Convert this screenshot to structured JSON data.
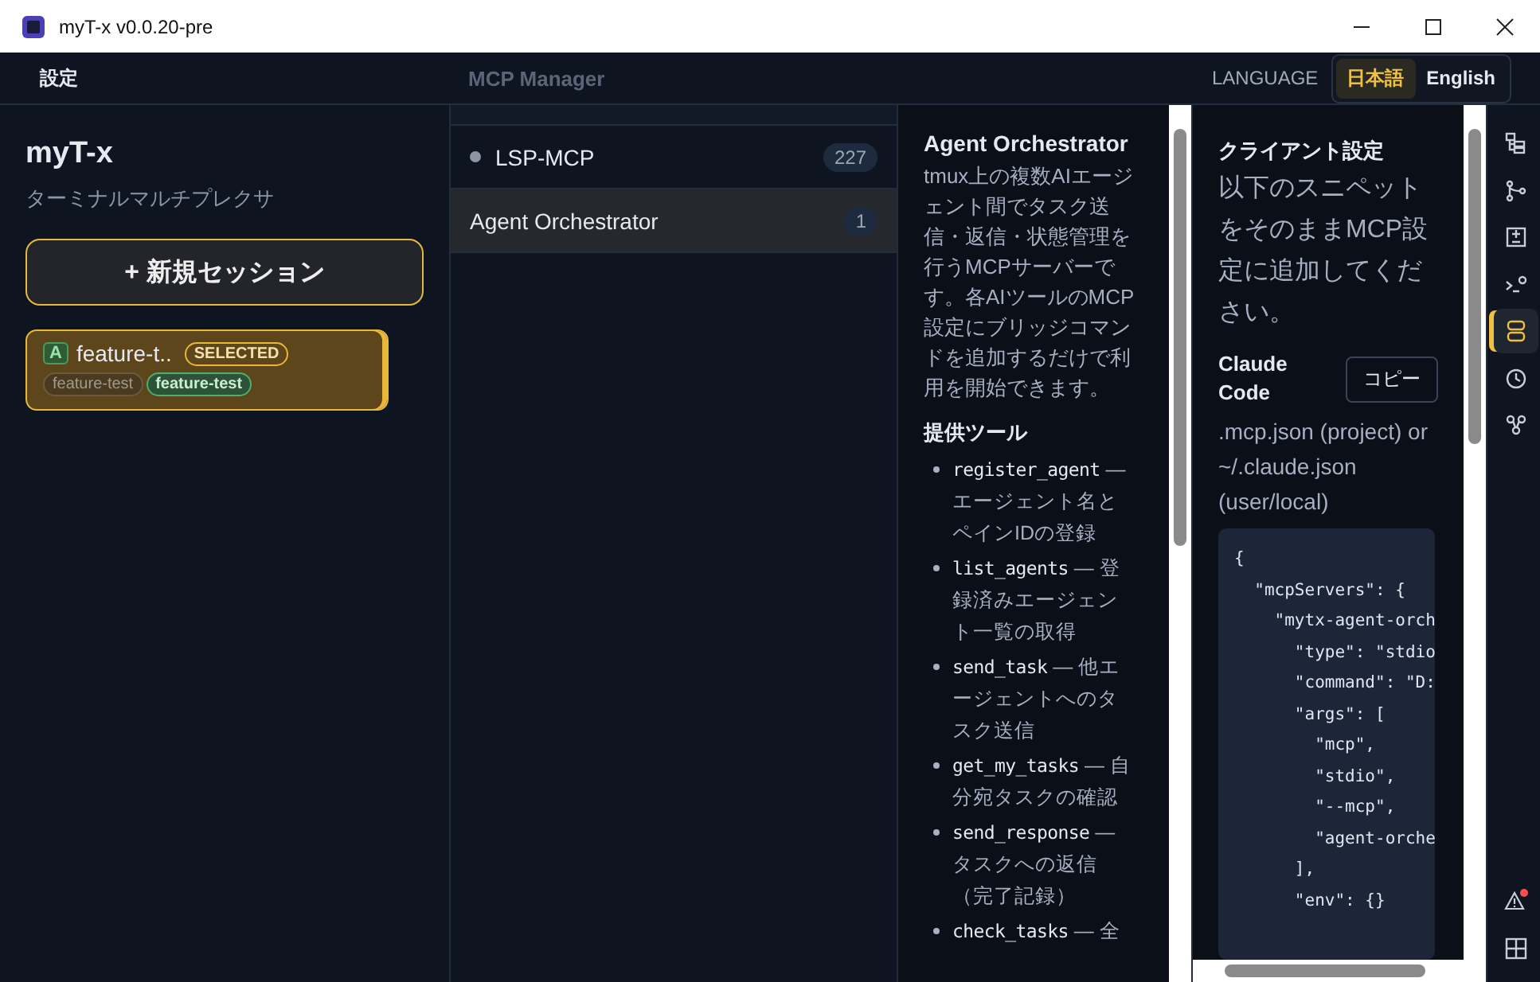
{
  "window": {
    "title": "myT-x v0.0.20-pre"
  },
  "menu": {
    "settings": "設定",
    "language_label": "LANGUAGE",
    "languages": [
      {
        "label": "日本語",
        "selected": true
      },
      {
        "label": "English",
        "selected": false
      }
    ],
    "panel_title": "MCP Manager"
  },
  "sidebar": {
    "app_name": "myT-x",
    "subtitle": "ターミナルマルチプレクサ",
    "new_session": "+ 新規セッション",
    "sessions": [
      {
        "badge": "A",
        "name": "feature-t..",
        "status": "SELECTED",
        "selected": true,
        "tags": [
          {
            "label": "feature-test",
            "kind": "branch"
          },
          {
            "label": "feature-test",
            "kind": "worktree"
          }
        ]
      }
    ]
  },
  "servers": [
    {
      "name": "LSP-MCP",
      "count": "227",
      "dot": true,
      "selected": false
    },
    {
      "name": "Agent Orchestrator",
      "count": "1",
      "dot": false,
      "selected": true
    }
  ],
  "detail": {
    "title": "Agent Orchestrator",
    "description": "tmux上の複数AIエージェント間でタスク送信・返信・状態管理を行うMCPサーバーです。各AIツールのMCP設定にブリッジコマンドを追加するだけで利用を開始できます。",
    "tools_heading": "提供ツール",
    "tools": [
      {
        "name": "register_agent",
        "text": "— エージェント名とペインIDの登録"
      },
      {
        "name": "list_agents",
        "text": "— 登録済みエージェント一覧の取得"
      },
      {
        "name": "send_task",
        "text": "— 他エージェントへのタスク送信"
      },
      {
        "name": "get_my_tasks",
        "text": "— 自分宛タスクの確認"
      },
      {
        "name": "send_response",
        "text": "— タスクへの返信（完了記録）"
      },
      {
        "name": "check_tasks",
        "text": "— 全"
      }
    ]
  },
  "client": {
    "heading": "クライアント設定",
    "description": "以下のスニペットをそのままMCP設定に追加してください。",
    "client_name": "Claude Code",
    "copy": "コピー",
    "path": ".mcp.json (project) or ~/.claude.json (user/local)",
    "code": [
      "{",
      "  \"mcpServers\": {",
      "    \"mytx-agent-orch",
      "      \"type\": \"stdio",
      "      \"command\": \"D:",
      "      \"args\": [",
      "        \"mcp\",",
      "        \"stdio\",",
      "        \"--mcp\",",
      "        \"agent-orche",
      "      ],",
      "      \"env\": {}"
    ]
  },
  "activity_bar": [
    {
      "selected": false
    },
    {
      "selected": false
    },
    {
      "selected": false
    },
    {
      "selected": false
    },
    {
      "selected": true
    },
    {
      "selected": false
    },
    {
      "selected": false
    }
  ],
  "alerts": {
    "unread": true
  }
}
